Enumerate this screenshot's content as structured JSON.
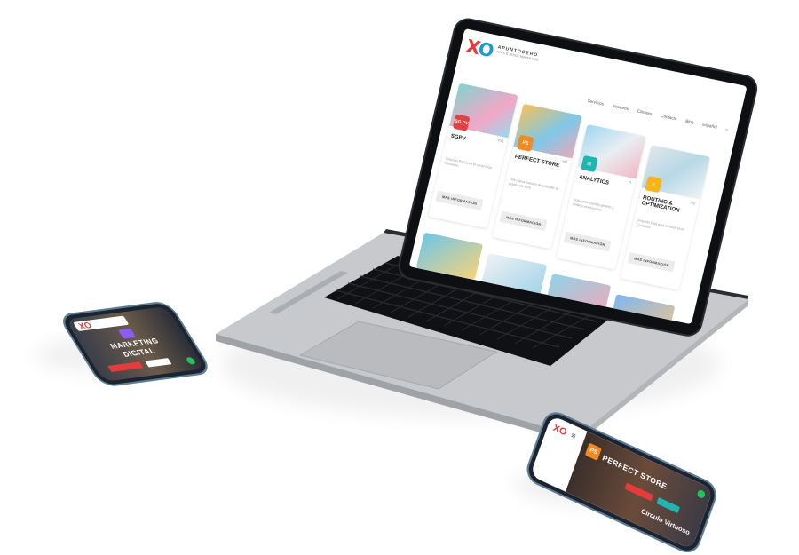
{
  "laptop": {
    "site": {
      "logo_mark_x": "X",
      "logo_mark_o": "O",
      "logo_name": "APUNTOCERO",
      "logo_tagline": "APPS & TRADE MARKETING",
      "nav": [
        "Servicios",
        "Nosotros",
        "Clientes",
        "Contacto",
        "Blog",
        "Español"
      ],
      "cards": [
        {
          "title": "SGPV",
          "badge": "SG PV",
          "desc": "Solución Pokt para el canal Gran Consumo.",
          "button": "MÁS INFORMACIÓN"
        },
        {
          "title": "PERFECT STORE",
          "badge": "PS",
          "desc": "Una nueva manera de entender la gestión del PdV.",
          "button": "MÁS INFORMACIÓN"
        },
        {
          "title": "ANALYTICS",
          "badge": "",
          "desc": "Soluciones para la gestión y análisis promocional.",
          "button": "MÁS INFORMACIÓN"
        },
        {
          "title": "ROUTING & OPTIMIZATION",
          "badge": "",
          "desc": "Solución Pokt para el canal Gran Consumo.",
          "button": "MÁS INFORMACIÓN"
        }
      ]
    }
  },
  "phone_left": {
    "logo": "XO",
    "headline_1": "MARKETING",
    "headline_2": "DIGITAL"
  },
  "phone_right": {
    "logo": "XO",
    "badge": "PS",
    "headline": "PERFECT STORE",
    "side_text": "Círculo Virtuoso"
  },
  "colors": {
    "brand_red": "#e53b3b",
    "brand_blue": "#1e9bd7",
    "badge_red": "#e2413f",
    "badge_orange": "#f08a24",
    "badge_teal": "#1fb5b0",
    "badge_yellow": "#f4b41a",
    "device_frame": "#5f7d93",
    "laptop_silver": "#c9cbcf"
  }
}
